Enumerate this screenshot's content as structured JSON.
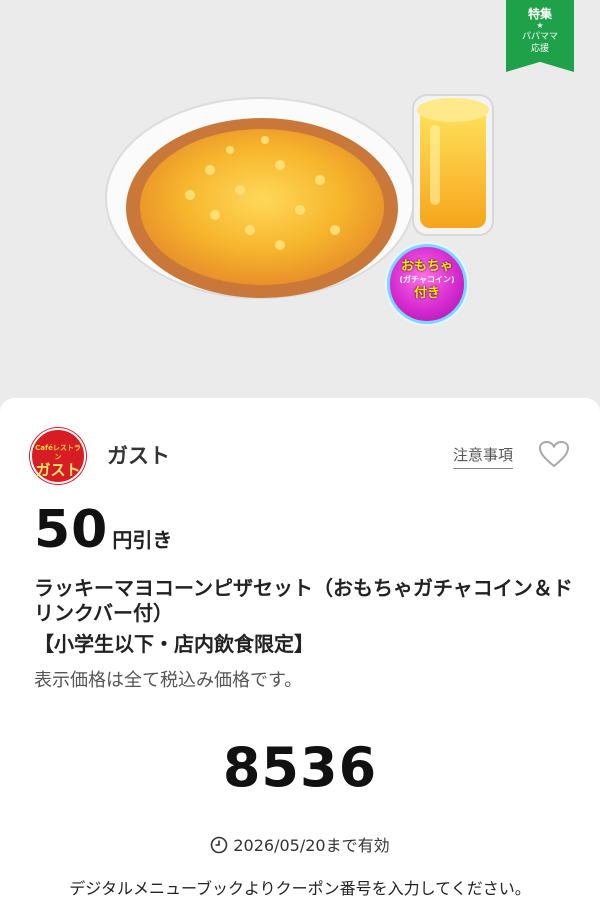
{
  "hero": {
    "tag_title": "特集",
    "tag_star": "★",
    "tag_subtitle_line1": "パパママ",
    "tag_subtitle_line2": "応援",
    "badge_line1": "おもちゃ",
    "badge_line2": "(ガチャコイン)",
    "badge_line3": "付き"
  },
  "shop": {
    "logo_line1": "Caféレストラン",
    "logo_line2": "ガスト",
    "name": "ガスト",
    "notes_link": "注意事項",
    "favorite_icon": "heart-outline-icon"
  },
  "coupon": {
    "discount_amount": "50",
    "discount_unit": "円引き",
    "title": "ラッキーマヨコーンピザセット（おもちゃガチャコイン＆ドリンクバー付）",
    "restriction": "【小学生以下・店内飲食限定】",
    "tax_note": "表示価格は全て税込み価格です。",
    "code": "8536",
    "expiry": "2026/05/20まで有効",
    "instruction": "デジタルメニューブックよりクーポン番号を入力してください。"
  },
  "colors": {
    "tag_green": "#1fa14a",
    "brand_red": "#d81c24",
    "background": "#ebebeb"
  }
}
